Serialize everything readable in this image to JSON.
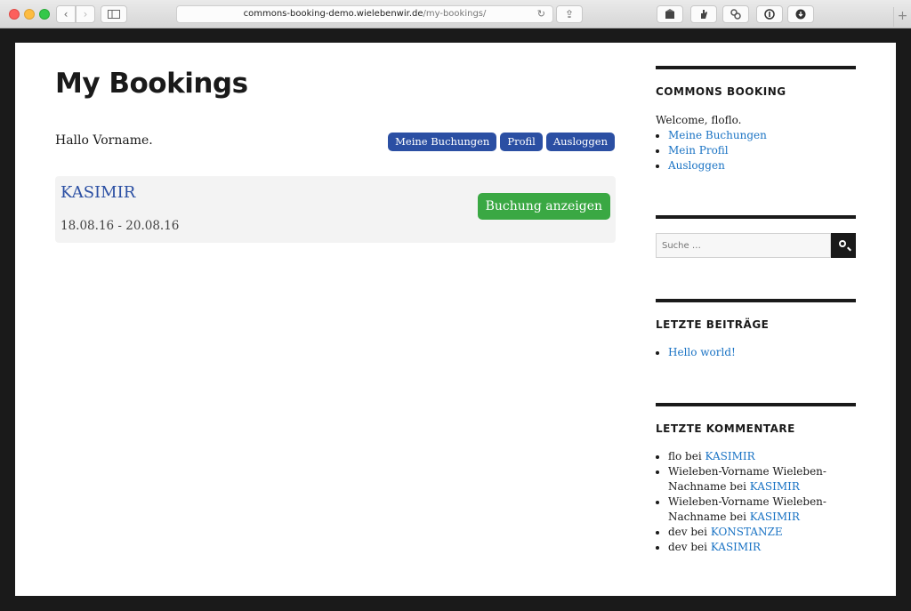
{
  "browser": {
    "url_host": "commons-booking-demo.wielebenwir.de",
    "url_path": "/my-bookings/",
    "icons": {
      "back": "‹",
      "forward": "›",
      "reload": "↻",
      "share": "⇪",
      "new_tab": "+"
    }
  },
  "page": {
    "title": "My Bookings",
    "greeting": "Hallo Vorname.",
    "top_buttons": [
      "Meine Buchungen",
      "Profil",
      "Ausloggen"
    ],
    "booking": {
      "name": "KASIMIR",
      "dates": "18.08.16 - 20.08.16",
      "show_label": "Buchung anzeigen"
    }
  },
  "sidebar": {
    "commons_booking": {
      "title": "COMMONS BOOKING",
      "welcome": "Welcome, floflo.",
      "links": [
        "Meine Buchungen",
        "Mein Profil",
        "Ausloggen"
      ]
    },
    "search": {
      "placeholder": "Suche …"
    },
    "recent_posts": {
      "title": "LETZTE BEITRÄGE",
      "items": [
        "Hello world!"
      ]
    },
    "recent_comments": {
      "title": "LETZTE KOMMENTARE",
      "items": [
        {
          "author": "flo",
          "sep": " bei ",
          "post": "KASIMIR"
        },
        {
          "author": "Wieleben-Vorname Wieleben-Nachname",
          "sep": " bei ",
          "post": "KASIMIR"
        },
        {
          "author": "Wieleben-Vorname Wieleben-Nachname",
          "sep": " bei ",
          "post": "KASIMIR"
        },
        {
          "author": "dev",
          "sep": " bei ",
          "post": "KONSTANZE"
        },
        {
          "author": "dev",
          "sep": " bei ",
          "post": "KASIMIR"
        }
      ]
    }
  },
  "colors": {
    "primary_button": "#2b4fa3",
    "success_button": "#3aa843",
    "link": "#1a73c4"
  }
}
